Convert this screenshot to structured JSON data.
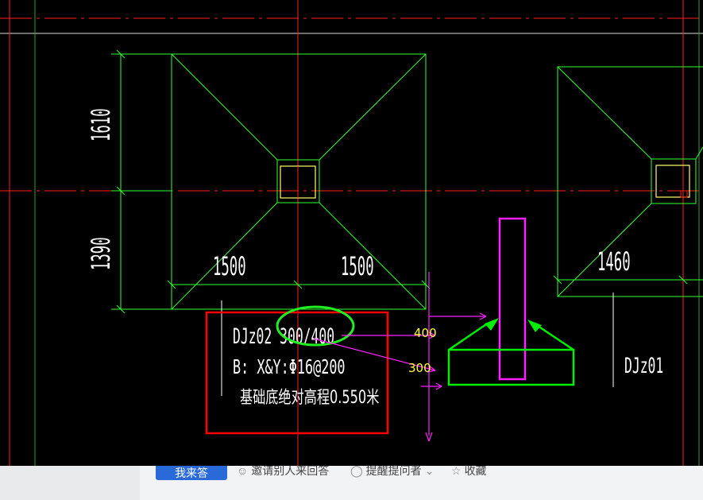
{
  "drawing": {
    "dimensions": {
      "left_upper": "1610",
      "left_lower": "1390",
      "bottom_left": "1500",
      "bottom_right": "1500",
      "right_footing": "1460"
    },
    "labels": {
      "footing_id": "DJz02 300/400",
      "rebar": "B: X&Y:Φ16@200",
      "elevation_note": "基础底绝对高程0.550米",
      "right_footing_id": "DJz01"
    },
    "annotations": {
      "upper": "400",
      "lower": "300"
    },
    "colors": {
      "background": "#000000",
      "grid_axis": "#ff2020",
      "footing": "#33ff33",
      "column": "#ffff66",
      "markup_box": "#ff0000",
      "markup_circle": "#22ee22",
      "markup_section": "#00ee00",
      "magenta": "#ff22ff"
    }
  },
  "toolbar": {
    "primary_button": "我来答",
    "invite_label": "邀请别人来回答",
    "remind_label": "提醒提问者",
    "collect_label": "收藏"
  }
}
